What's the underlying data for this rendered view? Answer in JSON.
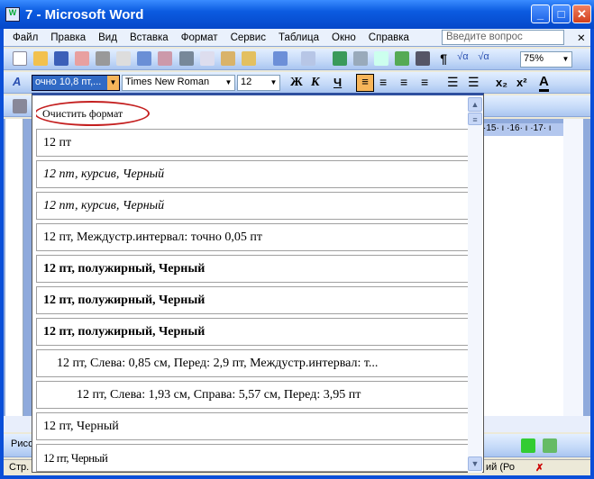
{
  "window": {
    "title": "7 - Microsoft Word",
    "app_icon": "word-icon",
    "minimize": "_",
    "maximize": "□",
    "close": "✕"
  },
  "menu": {
    "items": [
      "Файл",
      "Правка",
      "Вид",
      "Вставка",
      "Формат",
      "Сервис",
      "Таблица",
      "Окно",
      "Справка"
    ],
    "ask_placeholder": "Введите вопрос",
    "close": "✕"
  },
  "standard_toolbar": {
    "zoom": "75%"
  },
  "formatting_toolbar": {
    "style": "очно 10,8 пт,...",
    "font": "Times New Roman",
    "size": "12",
    "bold": "Ж",
    "italic": "К",
    "underline": "Ч",
    "subscript": "x₂",
    "superscript": "x²",
    "font_color": "A",
    "accent": "#f7b55a"
  },
  "style_dropdown": {
    "clear_format": "Очистить формат",
    "items": [
      {
        "label": "12 пт",
        "style": "normal"
      },
      {
        "label": "12 пт, курсив, Черный",
        "style": "italic"
      },
      {
        "label": "12 пт, курсив, Черный",
        "style": "italic"
      },
      {
        "label": "12 пт, Междустр.интервал:  точно 0,05 пт",
        "style": "normal"
      },
      {
        "label": "12 пт, полужирный, Черный",
        "style": "bold"
      },
      {
        "label": "12 пт, полужирный, Черный",
        "style": "bold"
      },
      {
        "label": "12 пт,  полужирный,  Черный",
        "style": "bold"
      },
      {
        "label": "12 пт, Слева:  0,85 см, Перед:  2,9 пт, Междустр.интервал:  т...",
        "style": "indent1"
      },
      {
        "label": "12 пт, Слева:  1,93 см, Справа:  5,57 см, Перед:  3,95 пт",
        "style": "indent2"
      },
      {
        "label": "12 пт, Черный",
        "style": "normal"
      },
      {
        "label": "12 пт, Черный",
        "style": "narrow"
      }
    ]
  },
  "ruler": {
    "marks": "·15· ı ·16· ı ·17· ı"
  },
  "drawing_toolbar": {
    "label": "Рисо"
  },
  "status_bar": {
    "page": "Стр.",
    "lang": "ий (Ро"
  }
}
